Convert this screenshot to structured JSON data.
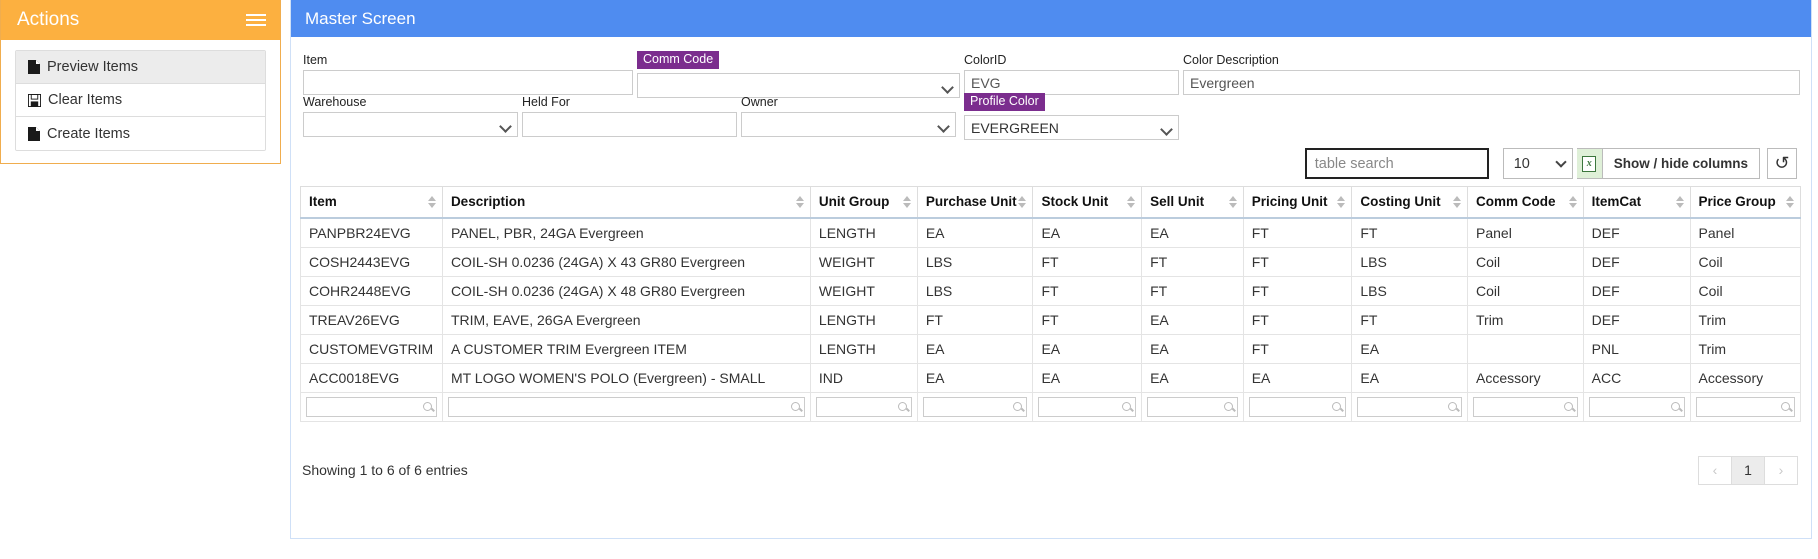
{
  "sidebar": {
    "title": "Actions",
    "menu_icon": "hamburger-icon",
    "items": [
      {
        "label": "Preview Items",
        "icon": "file-icon",
        "active": true
      },
      {
        "label": "Clear Items",
        "icon": "save-icon",
        "active": false
      },
      {
        "label": "Create Items",
        "icon": "file-icon",
        "active": false
      }
    ]
  },
  "main": {
    "title": "Master Screen",
    "header_color": "#4f8cf0",
    "sidebar_header_color": "#fcb040",
    "badge_color": "#7b2d8e",
    "form": {
      "item": {
        "label": "Item",
        "value": "",
        "type": "text"
      },
      "comm_code": {
        "label": "Comm Code",
        "value": "",
        "type": "select",
        "badge": true
      },
      "color_id": {
        "label": "ColorID",
        "value": "EVG",
        "type": "text"
      },
      "color_description": {
        "label": "Color Description",
        "value": "Evergreen",
        "type": "text"
      },
      "warehouse": {
        "label": "Warehouse",
        "value": "",
        "type": "select"
      },
      "held_for": {
        "label": "Held For",
        "value": "",
        "type": "text"
      },
      "owner": {
        "label": "Owner",
        "value": "",
        "type": "select"
      },
      "profile_color": {
        "label": "Profile Color",
        "value": "EVERGREEN",
        "type": "select",
        "badge": true
      }
    },
    "toolbar": {
      "search_placeholder": "table search",
      "page_length": "10",
      "excel_icon": "excel-export-icon",
      "show_hide_columns": "Show / hide columns",
      "reset_icon": "reset-icon",
      "reset_glyph": "↺"
    },
    "table": {
      "columns": [
        "Item",
        "Description",
        "Unit Group",
        "Purchase Unit",
        "Stock Unit",
        "Sell Unit",
        "Pricing Unit",
        "Costing Unit",
        "Comm Code",
        "ItemCat",
        "Price Group"
      ],
      "rows": [
        [
          "PANPBR24EVG",
          "PANEL, PBR, 24GA Evergreen",
          "LENGTH",
          "EA",
          "EA",
          "EA",
          "FT",
          "FT",
          "Panel",
          "DEF",
          "Panel"
        ],
        [
          "COSH2443EVG",
          "COIL-SH 0.0236 (24GA) X 43 GR80 Evergreen",
          "WEIGHT",
          "LBS",
          "FT",
          "FT",
          "FT",
          "LBS",
          "Coil",
          "DEF",
          "Coil"
        ],
        [
          "COHR2448EVG",
          "COIL-SH 0.0236 (24GA) X 48 GR80 Evergreen",
          "WEIGHT",
          "LBS",
          "FT",
          "FT",
          "FT",
          "LBS",
          "Coil",
          "DEF",
          "Coil"
        ],
        [
          "TREAV26EVG",
          "TRIM, EAVE, 26GA Evergreen",
          "LENGTH",
          "FT",
          "FT",
          "EA",
          "FT",
          "FT",
          "Trim",
          "DEF",
          "Trim"
        ],
        [
          "CUSTOMEVGTRIM",
          "A CUSTOMER TRIM Evergreen ITEM",
          "LENGTH",
          "EA",
          "EA",
          "EA",
          "FT",
          "EA",
          "",
          "PNL",
          "Trim"
        ],
        [
          "ACC0018EVG",
          "MT LOGO WOMEN'S POLO (Evergreen) - SMALL",
          "IND",
          "EA",
          "EA",
          "EA",
          "EA",
          "EA",
          "Accessory",
          "ACC",
          "Accessory"
        ]
      ],
      "filter_icon": "search-icon"
    },
    "footer": {
      "showing": "Showing 1 to 6 of 6 entries",
      "prev": "‹",
      "page": "1",
      "next": "›"
    }
  }
}
